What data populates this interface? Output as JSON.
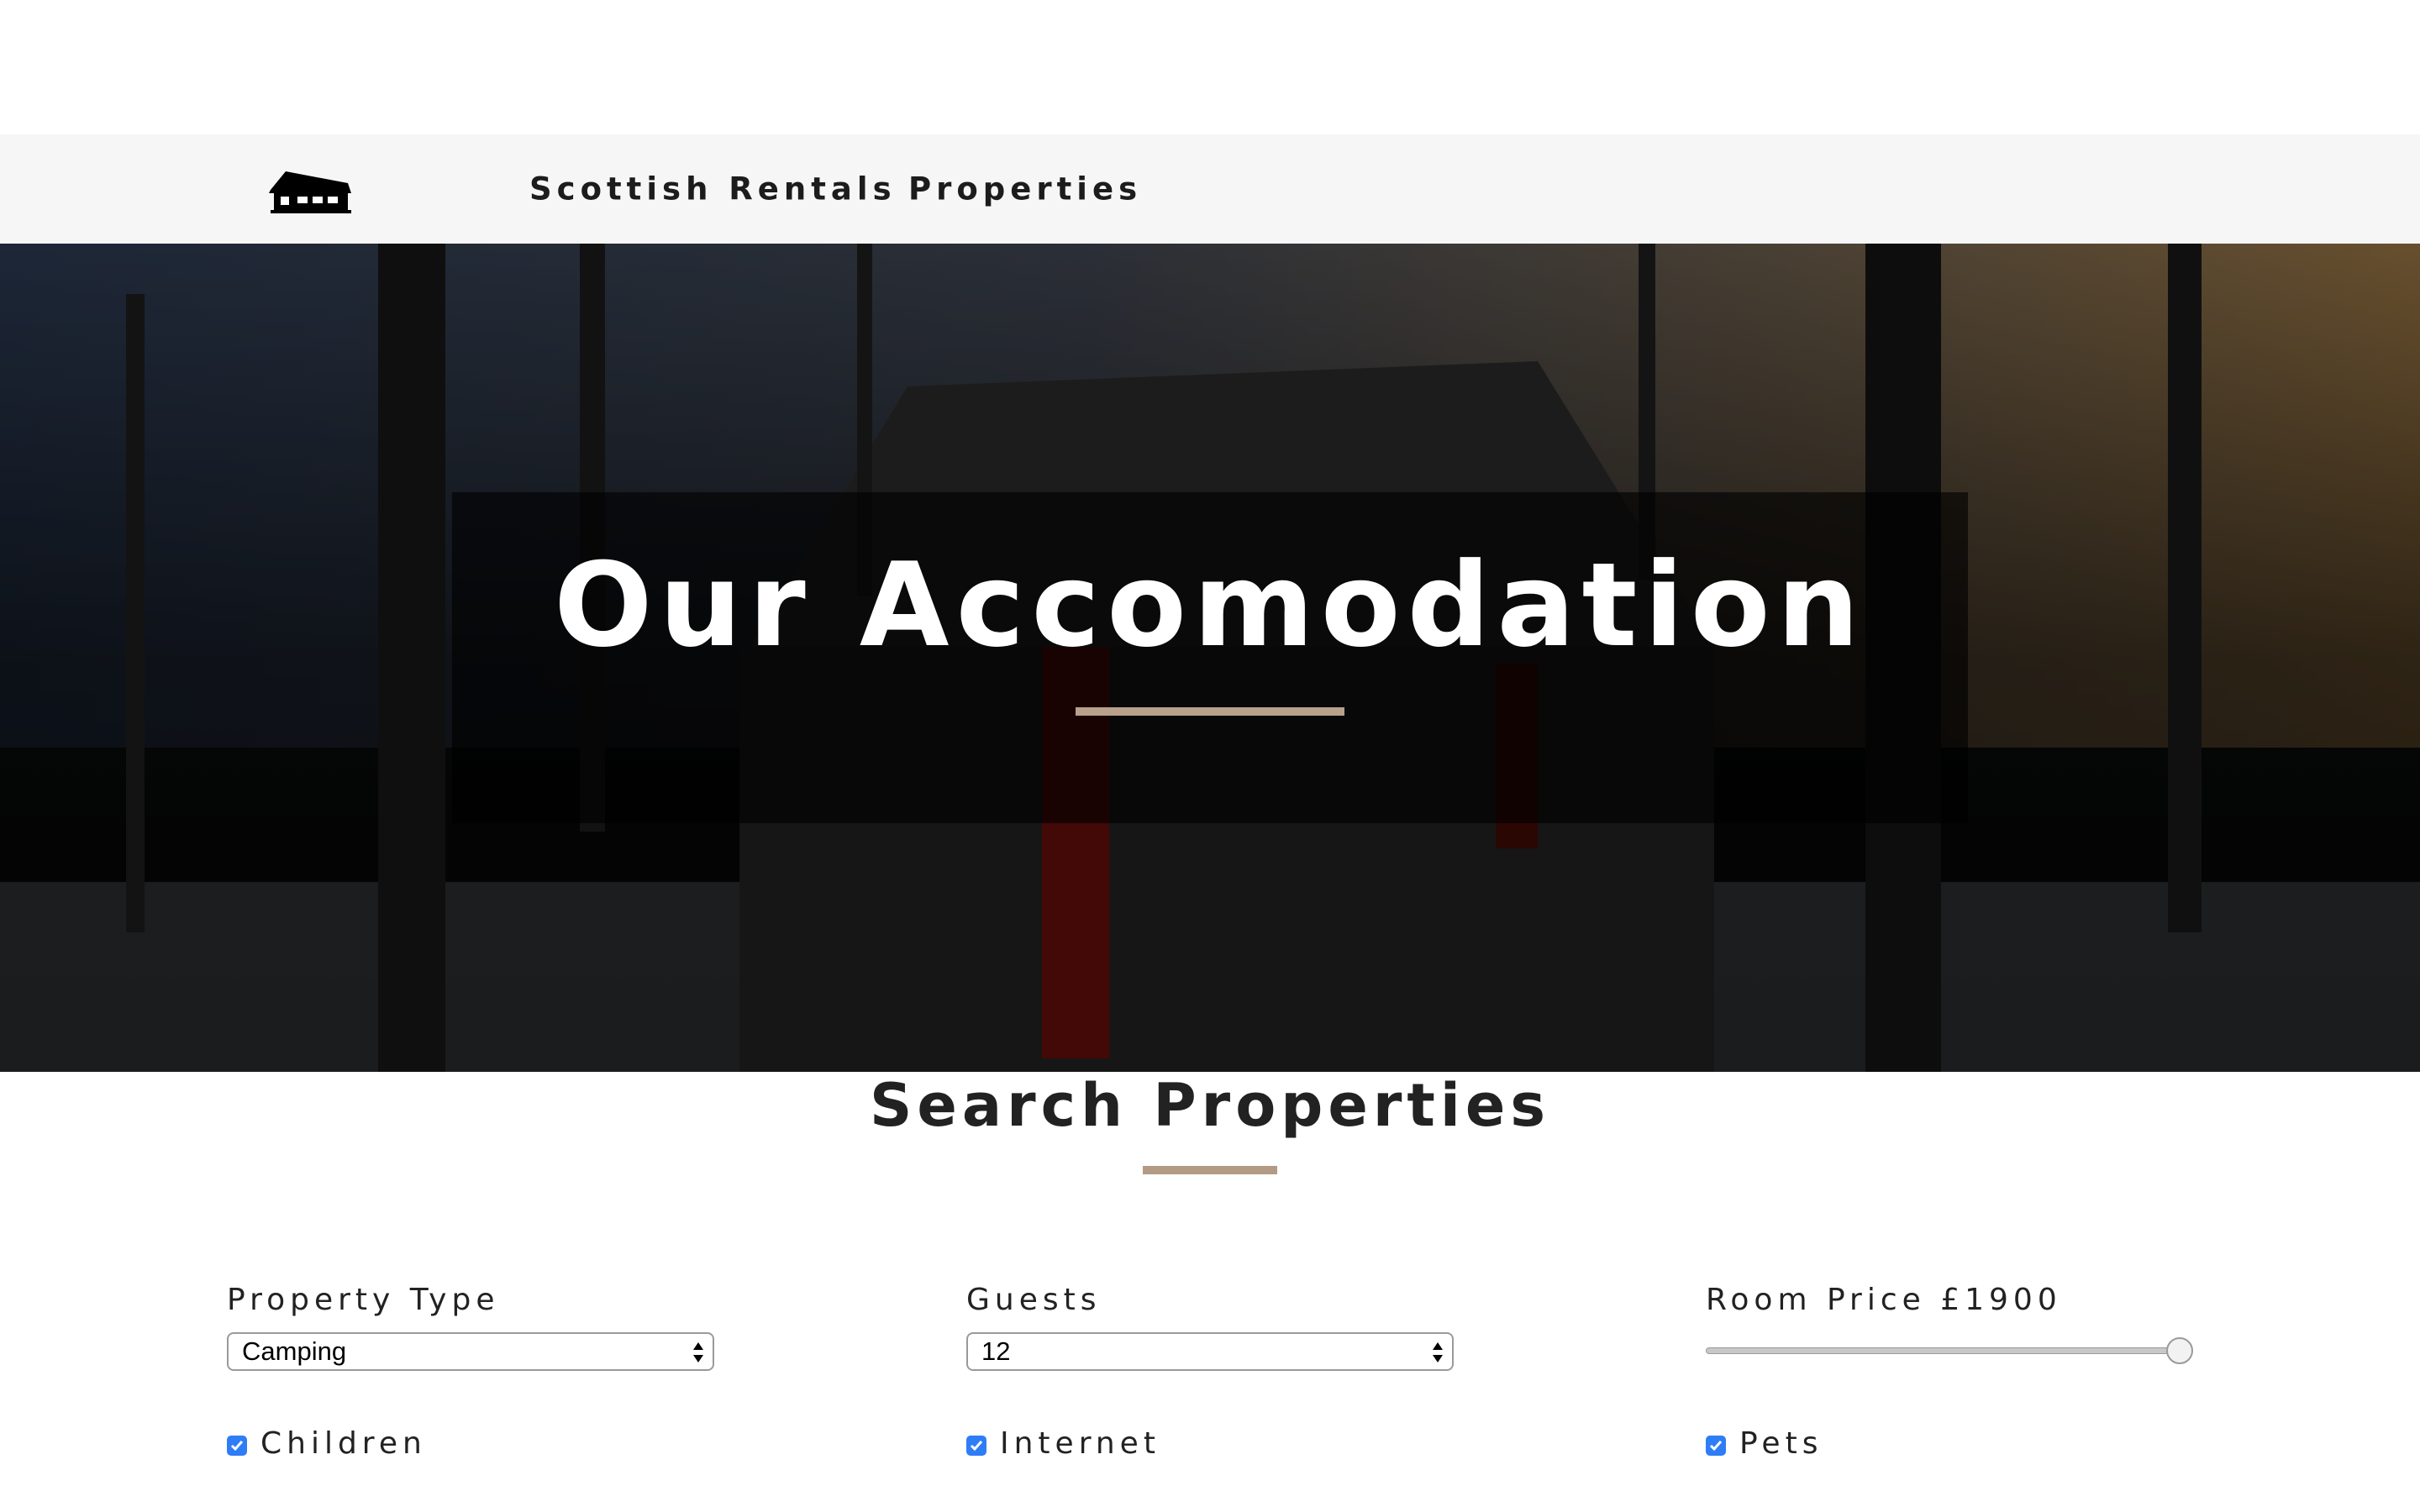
{
  "nav": {
    "logo_icon": "cabin-icon",
    "brand": "Scottish Rentals",
    "properties": "Properties"
  },
  "hero": {
    "title": "Our Accomodation"
  },
  "search": {
    "title": "Search Properties",
    "property_type": {
      "label": "Property Type",
      "selected": "Camping"
    },
    "guests": {
      "label": "Guests",
      "selected": "12"
    },
    "room_price": {
      "label": "Room Price £1900",
      "value": 1900
    },
    "checkboxes": [
      {
        "label": "Children",
        "checked": true
      },
      {
        "label": "Internet",
        "checked": true
      },
      {
        "label": "Pets",
        "checked": true
      }
    ]
  },
  "colors": {
    "accent_rule": "#b8a08a",
    "nav_bg": "#f6f6f6",
    "checkbox": "#2f7df6"
  }
}
